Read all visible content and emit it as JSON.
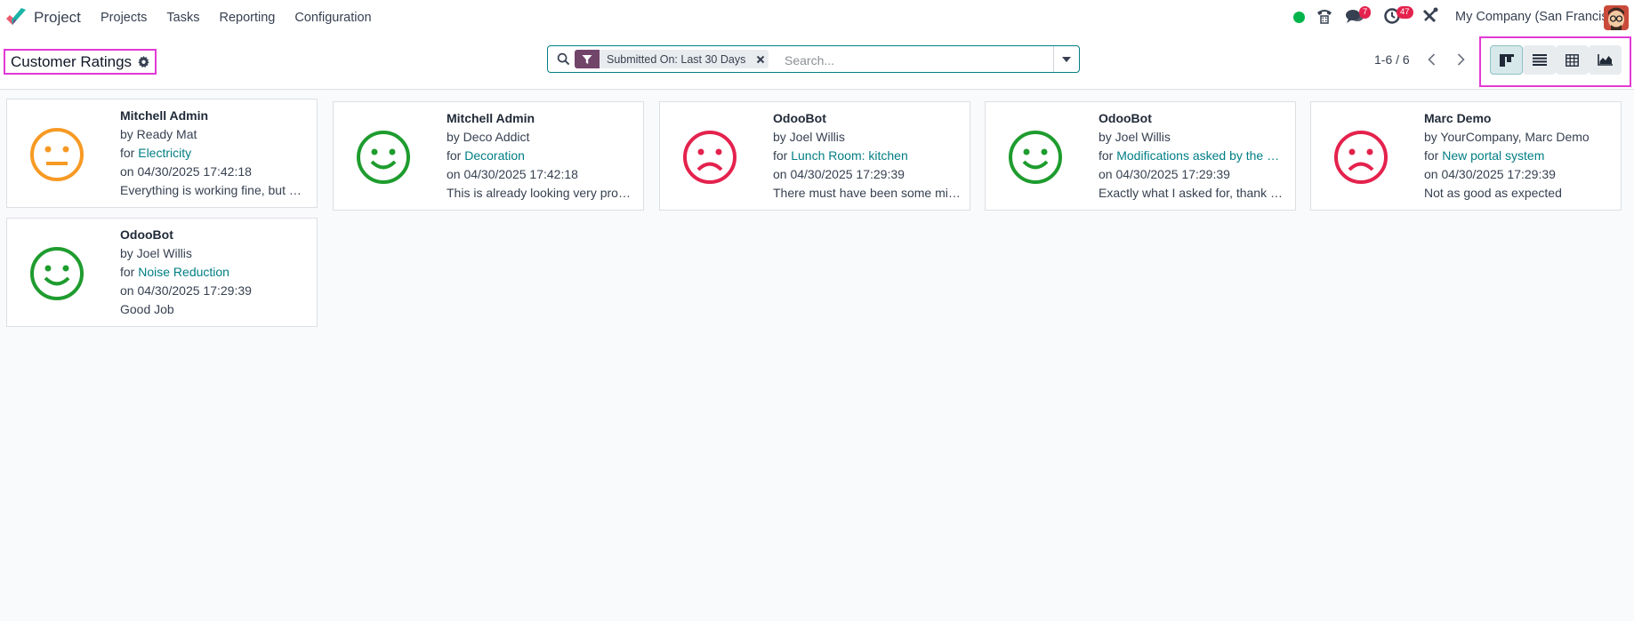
{
  "navbar": {
    "app_name": "Project",
    "menu": [
      "Projects",
      "Tasks",
      "Reporting",
      "Configuration"
    ],
    "messages_badge": "7",
    "activities_badge": "47",
    "company": "My Company (San Francisco)"
  },
  "control": {
    "title": "Customer Ratings",
    "facet": "Submitted On: Last 30 Days",
    "search_placeholder": "Search...",
    "pager": "1-6 / 6"
  },
  "colors": {
    "accent": "#017e84",
    "satisfied": "#1e9c2e",
    "neutral": "#f79a24",
    "dissatisfied": "#e4224d",
    "highlight_outline": "#e339d4"
  },
  "cards": [
    {
      "author": "Mitchell Admin",
      "by": "by Ready Mat",
      "for": "for ",
      "task": "Electricity",
      "date": "on 04/30/2025 17:42:18",
      "feedback": "Everything is working fine, but …",
      "rating": "neutral"
    },
    {
      "author": "Mitchell Admin",
      "by": "by Deco Addict",
      "for": "for ",
      "task": "Decoration",
      "date": "on 04/30/2025 17:42:18",
      "feedback": "This is already looking very pro…",
      "rating": "satisfied"
    },
    {
      "author": "OdooBot",
      "by": "by Joel Willis",
      "for": "for ",
      "task": "Lunch Room: kitchen",
      "date": "on 04/30/2025 17:29:39",
      "feedback": "There must have been some mi…",
      "rating": "dissatisfied"
    },
    {
      "author": "OdooBot",
      "by": "by Joel Willis",
      "for": "for ",
      "task": "Modifications asked by the …",
      "date": "on 04/30/2025 17:29:39",
      "feedback": "Exactly what I asked for, thank …",
      "rating": "satisfied"
    },
    {
      "author": "Marc Demo",
      "by": "by YourCompany, Marc Demo",
      "for": "for ",
      "task": "New portal system",
      "date": "on 04/30/2025 17:29:39",
      "feedback": "Not as good as expected",
      "rating": "dissatisfied"
    },
    {
      "author": "OdooBot",
      "by": "by Joel Willis",
      "for": "for ",
      "task": "Noise Reduction",
      "date": "on 04/30/2025 17:29:39",
      "feedback": "Good Job",
      "rating": "satisfied"
    }
  ]
}
